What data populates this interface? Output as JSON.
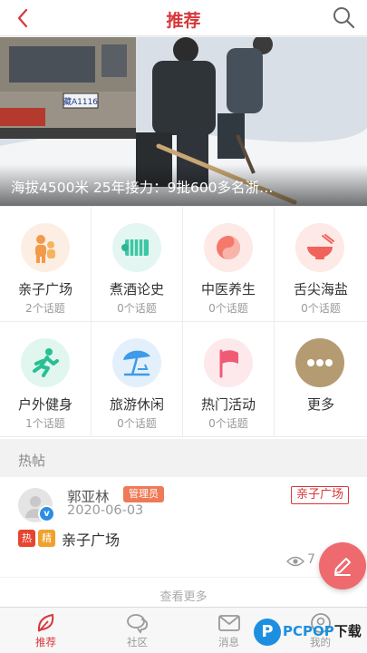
{
  "header": {
    "title": "推荐",
    "back_icon": "back-chevron-icon",
    "search_icon": "search-icon",
    "accent_color": "#d8373a"
  },
  "banner": {
    "caption": "海拔4500米 25年接力：9批600多名浙…",
    "plate_text": "藏A1116"
  },
  "categories": [
    {
      "name": "亲子广场",
      "count": "2个话题",
      "icon": "family-icon",
      "bg": "#fdeee4"
    },
    {
      "name": "煮酒论史",
      "count": "0个话题",
      "icon": "bamboo-scroll-icon",
      "bg": "#e3f6f1"
    },
    {
      "name": "中医养生",
      "count": "0个话题",
      "icon": "yin-yang-icon",
      "bg": "#fde9e6"
    },
    {
      "name": "舌尖海盐",
      "count": "0个话题",
      "icon": "bowl-icon",
      "bg": "#fde9e6"
    },
    {
      "name": "户外健身",
      "count": "1个话题",
      "icon": "running-icon",
      "bg": "#e1f6ef"
    },
    {
      "name": "旅游休闲",
      "count": "0个话题",
      "icon": "beach-umbrella-icon",
      "bg": "#e3f0fb"
    },
    {
      "name": "热门活动",
      "count": "0个话题",
      "icon": "flag-icon",
      "bg": "#fde9ec"
    },
    {
      "name": "更多",
      "count": "",
      "icon": "more-dots-icon",
      "bg": "#b59b72"
    }
  ],
  "section": {
    "title": "热帖"
  },
  "post": {
    "author": "郭亚林",
    "role": "管理员",
    "date": "2020-06-03",
    "category_tag": "亲子广场",
    "badge_hot": "热",
    "badge_featured": "精",
    "title": "亲子广场",
    "views": "7",
    "verified": "v"
  },
  "load_more": "查看更多",
  "tabbar": [
    {
      "label": "推荐",
      "icon": "leaf-icon",
      "active": true
    },
    {
      "label": "社区",
      "icon": "chat-bubbles-icon",
      "active": false
    },
    {
      "label": "消息",
      "icon": "envelope-icon",
      "active": false
    },
    {
      "label": "我的",
      "icon": "profile-icon",
      "active": false
    }
  ],
  "watermark": {
    "letter": "P",
    "text_a": "PCPOP",
    "text_b": "下载"
  }
}
